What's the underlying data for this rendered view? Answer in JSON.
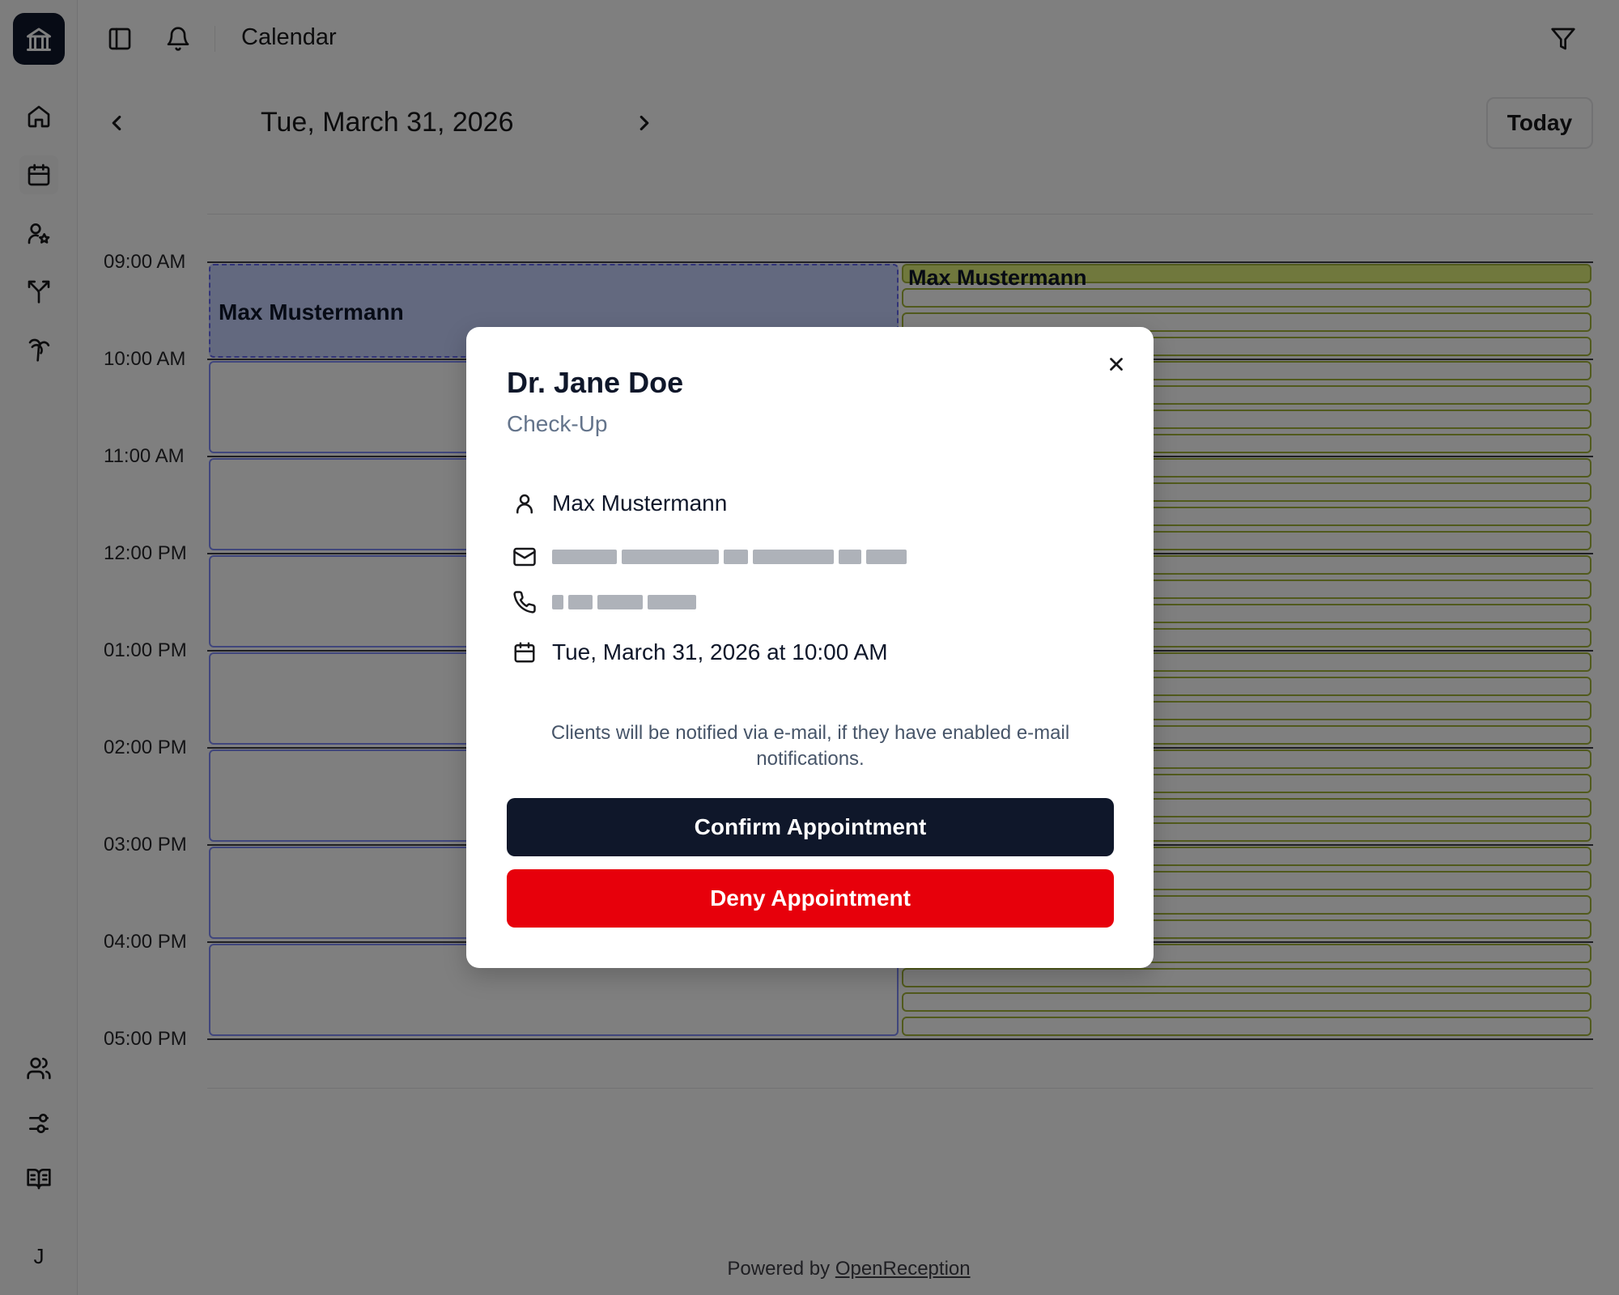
{
  "app": {
    "page_title": "Calendar"
  },
  "sidebar": {
    "items": [
      {
        "name": "home-icon"
      },
      {
        "name": "calendar-icon"
      },
      {
        "name": "user-star-icon"
      },
      {
        "name": "split-icon"
      },
      {
        "name": "palm-tree-icon"
      },
      {
        "name": "users-icon"
      },
      {
        "name": "settings-sliders-icon"
      },
      {
        "name": "book-open-icon"
      }
    ],
    "avatar_initial": "J"
  },
  "calendar": {
    "date": "Tue, March 31, 2026",
    "today_label": "Today",
    "times": [
      "09:00 AM",
      "10:00 AM",
      "11:00 AM",
      "12:00 PM",
      "01:00 PM",
      "02:00 PM",
      "03:00 PM",
      "04:00 PM",
      "05:00 PM"
    ],
    "booked_label": "Max Mustermann",
    "second_column_label": "Max Mustermann"
  },
  "modal": {
    "title": "Dr. Jane Doe",
    "subtitle": "Check-Up",
    "client_name": "Max Mustermann",
    "appointment_time": "Tue, March 31, 2026 at 10:00 AM",
    "notice": "Clients will be notified via e-mail, if they have enabled e-mail notifications.",
    "confirm_label": "Confirm Appointment",
    "deny_label": "Deny Appointment"
  },
  "footer": {
    "prefix": "Powered by ",
    "link_text": "OpenReception"
  },
  "colors": {
    "primary": "#0f172a",
    "danger": "#e7000b",
    "slot_border": "#818cf8",
    "booked_fill": "#c7d2fe",
    "yellow_fill": "#e0f07b"
  }
}
